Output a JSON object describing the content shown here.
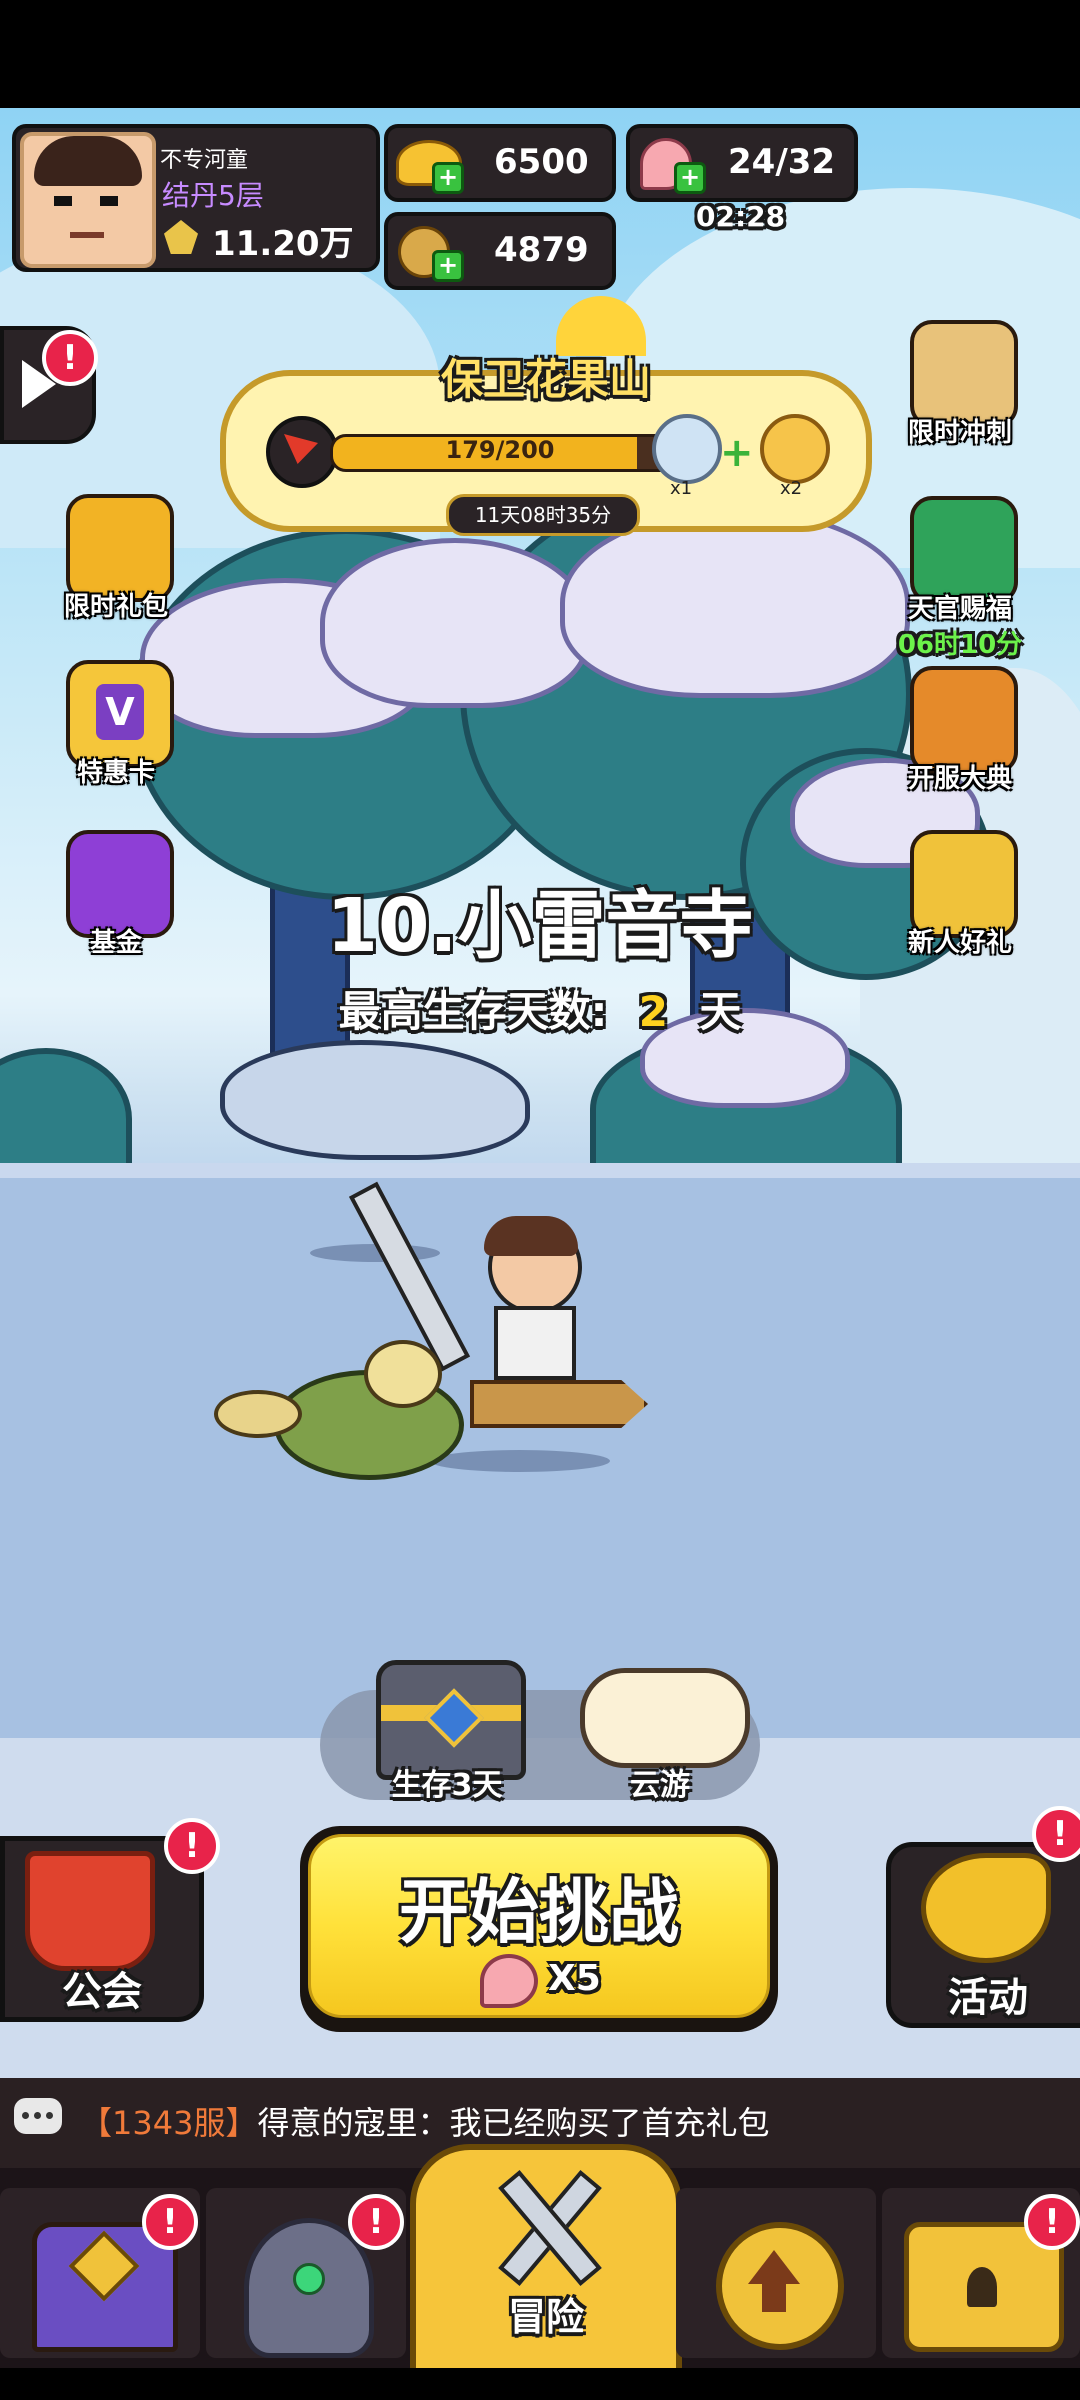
{
  "player": {
    "name": "不专河童",
    "realm": "结丹5层",
    "power": "11.20万"
  },
  "currencies": {
    "gold": "6500",
    "coin": "4879",
    "stamina": "24/32",
    "stamina_timer": "02:28"
  },
  "event": {
    "title": "保卫花果山",
    "progress_text": "179/200",
    "progress_fraction": 0.895,
    "reward1_count": "x1",
    "reward2_count": "x2",
    "countdown": "11天08时35分"
  },
  "left_menu": [
    {
      "label": "限时礼包",
      "icon": "gift-bag-icon"
    },
    {
      "label": "特惠卡",
      "icon": "vip-card-icon"
    },
    {
      "label": "基金",
      "icon": "fund-chart-icon"
    }
  ],
  "right_menu": [
    {
      "label": "限时冲刺",
      "icon": "hourglass-icon"
    },
    {
      "label": "天官赐福",
      "icon": "fan-icon",
      "timer": "06时10分"
    },
    {
      "label": "开服大典",
      "icon": "drum-icon"
    },
    {
      "label": "新人好礼",
      "icon": "gold-pot-icon"
    }
  ],
  "stage": {
    "name": "10.小雷音寺",
    "survival_label": "最高生存天数:",
    "survival_days": "2",
    "survival_unit": "天"
  },
  "chest_row": {
    "chest_label": "生存3天",
    "cloud_label": "云游"
  },
  "actions": {
    "guild_label": "公会",
    "start_label": "开始挑战",
    "start_cost": "X5",
    "activity_label": "活动"
  },
  "chat": {
    "server": "【1343服】",
    "message": "得意的寇里：我已经购买了首充礼包"
  },
  "nav": {
    "adventure_label": "冒险"
  },
  "badge_mark": "!"
}
